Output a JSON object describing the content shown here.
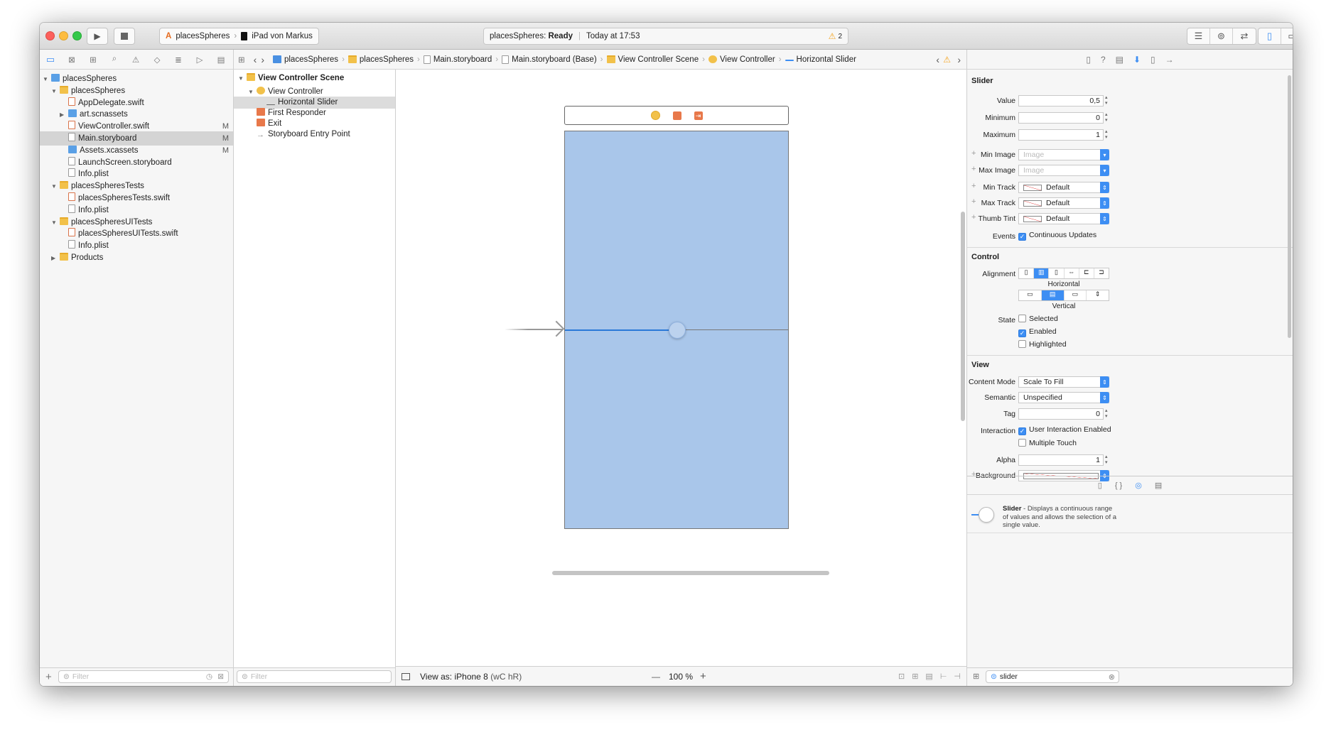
{
  "toolbar": {
    "run_icon": "play-icon",
    "stop_icon": "stop-icon",
    "scheme": "placesSpheres",
    "device": "iPad von Markus",
    "activity_project": "placesSpheres:",
    "activity_status": "Ready",
    "activity_time": "Today at 17:53",
    "warning_count": "2"
  },
  "jump_bar": {
    "items": [
      "placesSpheres",
      "placesSpheres",
      "Main.storyboard",
      "Main.storyboard (Base)",
      "View Controller Scene",
      "View Controller",
      "Horizontal Slider"
    ]
  },
  "navigator": {
    "items": [
      {
        "label": "placesSpheres",
        "indent": 0,
        "kind": "project",
        "expanded": true,
        "flag": ""
      },
      {
        "label": "placesSpheres",
        "indent": 1,
        "kind": "folder",
        "expanded": true,
        "flag": ""
      },
      {
        "label": "AppDelegate.swift",
        "indent": 2,
        "kind": "swift",
        "flag": ""
      },
      {
        "label": "art.scnassets",
        "indent": 2,
        "kind": "scnassets",
        "collapsed": true,
        "flag": ""
      },
      {
        "label": "ViewController.swift",
        "indent": 2,
        "kind": "swift",
        "flag": "M"
      },
      {
        "label": "Main.storyboard",
        "indent": 2,
        "kind": "storyboard",
        "flag": "M",
        "selected": true
      },
      {
        "label": "Assets.xcassets",
        "indent": 2,
        "kind": "assets",
        "flag": "M"
      },
      {
        "label": "LaunchScreen.storyboard",
        "indent": 2,
        "kind": "storyboard",
        "flag": ""
      },
      {
        "label": "Info.plist",
        "indent": 2,
        "kind": "plist",
        "flag": ""
      },
      {
        "label": "placesSpheresTests",
        "indent": 1,
        "kind": "folder",
        "expanded": true,
        "flag": ""
      },
      {
        "label": "placesSpheresTests.swift",
        "indent": 2,
        "kind": "swift",
        "flag": ""
      },
      {
        "label": "Info.plist",
        "indent": 2,
        "kind": "plist",
        "flag": ""
      },
      {
        "label": "placesSpheresUITests",
        "indent": 1,
        "kind": "folder",
        "expanded": true,
        "flag": ""
      },
      {
        "label": "placesSpheresUITests.swift",
        "indent": 2,
        "kind": "swift",
        "flag": ""
      },
      {
        "label": "Info.plist",
        "indent": 2,
        "kind": "plist",
        "flag": ""
      },
      {
        "label": "Products",
        "indent": 1,
        "kind": "folder",
        "collapsed": true,
        "flag": ""
      }
    ],
    "filter_placeholder": "Filter"
  },
  "outline": {
    "items": [
      {
        "label": "View Controller Scene",
        "indent": 0,
        "kind": "scene",
        "bold": true
      },
      {
        "label": "View Controller",
        "indent": 1,
        "kind": "vc"
      },
      {
        "label": "Horizontal Slider",
        "indent": 2,
        "kind": "slider",
        "selected": true
      },
      {
        "label": "First Responder",
        "indent": 1,
        "kind": "responder"
      },
      {
        "label": "Exit",
        "indent": 1,
        "kind": "exit"
      },
      {
        "label": "Storyboard Entry Point",
        "indent": 1,
        "kind": "entry"
      }
    ],
    "filter_placeholder": "Filter"
  },
  "canvas": {
    "view_as": "View as: iPhone 8",
    "size_class": "(wC hR)",
    "zoom": "100 %",
    "slider_value": 0.5,
    "minus": "—",
    "plus": "+"
  },
  "inspector": {
    "slider_section": "Slider",
    "value_label": "Value",
    "value": "0,5",
    "minimum_label": "Minimum",
    "minimum": "0",
    "maximum_label": "Maximum",
    "maximum": "1",
    "min_image_label": "Min Image",
    "min_image_placeholder": "Image",
    "max_image_label": "Max Image",
    "max_image_placeholder": "Image",
    "min_track_label": "Min Track",
    "min_track": "Default",
    "max_track_label": "Max Track",
    "max_track": "Default",
    "thumb_tint_label": "Thumb Tint",
    "thumb_tint": "Default",
    "events_label": "Events",
    "continuous_updates": "Continuous Updates",
    "control_section": "Control",
    "alignment_label": "Alignment",
    "horizontal": "Horizontal",
    "vertical": "Vertical",
    "state_label": "State",
    "selected": "Selected",
    "enabled": "Enabled",
    "highlighted": "Highlighted",
    "view_section": "View",
    "content_mode_label": "Content Mode",
    "content_mode": "Scale To Fill",
    "semantic_label": "Semantic",
    "semantic": "Unspecified",
    "tag_label": "Tag",
    "tag": "0",
    "interaction_label": "Interaction",
    "user_interaction": "User Interaction Enabled",
    "multiple_touch": "Multiple Touch",
    "alpha_label": "Alpha",
    "alpha": "1",
    "background_label": "Background"
  },
  "library": {
    "title": "Slider",
    "description": " - Displays a continuous range of values and allows the selection of a single value.",
    "search_value": "slider"
  },
  "colors": {
    "accent": "#3d8ef3",
    "canvas_view": "#a9c6ea",
    "folder": "#f2c14a"
  }
}
